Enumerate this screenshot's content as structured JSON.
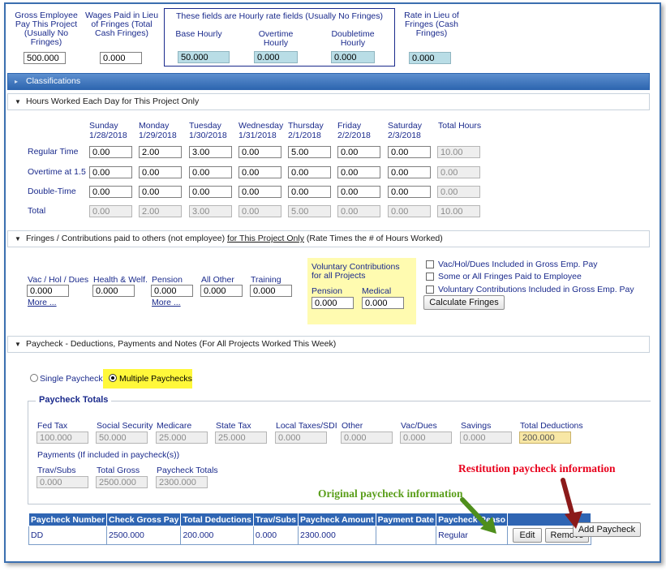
{
  "top": {
    "gross_label": "Gross Employee Pay This Project (Usually No Fringes)",
    "gross_value": "500.000",
    "wages_label": "Wages Paid in Lieu of Fringes (Total Cash Fringes)",
    "wages_value": "0.000",
    "hourly_box_title": "These fields are Hourly rate fields (Usually No Fringes)",
    "base_label": "Base Hourly",
    "base_value": "50.000",
    "overtime_label": "Overtime Hourly",
    "overtime_value": "0.000",
    "doubletime_label": "Doubletime Hourly",
    "doubletime_value": "0.000",
    "rate_label": "Rate in Lieu of Fringes (Cash Fringes)",
    "rate_value": "0.000"
  },
  "classifications": {
    "label": "Classifications"
  },
  "hours": {
    "header": "Hours Worked Each Day for This Project Only",
    "days": [
      {
        "name": "Sunday",
        "date": "1/28/2018"
      },
      {
        "name": "Monday",
        "date": "1/29/2018"
      },
      {
        "name": "Tuesday",
        "date": "1/30/2018"
      },
      {
        "name": "Wednesday",
        "date": "1/31/2018"
      },
      {
        "name": "Thursday",
        "date": "2/1/2018"
      },
      {
        "name": "Friday",
        "date": "2/2/2018"
      },
      {
        "name": "Saturday",
        "date": "2/3/2018"
      }
    ],
    "total_hours_label": "Total Hours",
    "rows": [
      {
        "label": "Regular Time",
        "values": [
          "0.00",
          "2.00",
          "3.00",
          "0.00",
          "5.00",
          "0.00",
          "0.00"
        ],
        "total": "10.00"
      },
      {
        "label": "Overtime at 1.5",
        "values": [
          "0.00",
          "0.00",
          "0.00",
          "0.00",
          "0.00",
          "0.00",
          "0.00"
        ],
        "total": "0.00"
      },
      {
        "label": "Double-Time",
        "values": [
          "0.00",
          "0.00",
          "0.00",
          "0.00",
          "0.00",
          "0.00",
          "0.00"
        ],
        "total": "0.00"
      },
      {
        "label": "Total",
        "values": [
          "0.00",
          "2.00",
          "3.00",
          "0.00",
          "5.00",
          "0.00",
          "0.00"
        ],
        "total": "10.00"
      }
    ]
  },
  "fringes": {
    "header_pre": "Fringes / Contributions paid to others (not employee) ",
    "header_link": "for This Project Only",
    "header_post": " (Rate Times the # of Hours Worked)",
    "vac_label": "Vac / Hol / Dues",
    "vac_value": "0.000",
    "health_label": "Health & Welf.",
    "health_value": "0.000",
    "pension_label": "Pension",
    "pension_value": "0.000",
    "allother_label": "All Other",
    "allother_value": "0.000",
    "training_label": "Training",
    "training_value": "0.000",
    "more_label": "More ...",
    "voluntary_title": "Voluntary Contributions for all Projects",
    "vol_pension_label": "Pension",
    "vol_pension_value": "0.000",
    "vol_medical_label": "Medical",
    "vol_medical_value": "0.000",
    "check1": "Vac/Hol/Dues Included in Gross Emp. Pay",
    "check2": "Some or All Fringes Paid to Employee",
    "check3": "Voluntary Contributions Included in Gross Emp. Pay",
    "calc_button": "Calculate Fringes"
  },
  "paycheck": {
    "header": "Paycheck - Deductions, Payments and Notes (For All Projects Worked This Week)",
    "single_label": "Single Paycheck",
    "multiple_label": "Multiple Paychecks",
    "totals_title": "Paycheck Totals",
    "fields": [
      {
        "label": "Fed Tax",
        "value": "100.000"
      },
      {
        "label": "Social Security",
        "value": "50.000"
      },
      {
        "label": "Medicare",
        "value": "25.000"
      },
      {
        "label": "State Tax",
        "value": "25.000"
      },
      {
        "label": "Local Taxes/SDI",
        "value": "0.000"
      },
      {
        "label": "Other",
        "value": "0.000"
      },
      {
        "label": "Vac/Dues",
        "value": "0.000"
      },
      {
        "label": "Savings",
        "value": "0.000"
      },
      {
        "label": "Total Deductions",
        "value": "200.000"
      }
    ],
    "payments_label": "Payments (If included in paycheck(s))",
    "trav_label": "Trav/Subs",
    "trav_value": "0.000",
    "total_gross_label": "Total Gross",
    "total_gross_value": "2500.000",
    "paycheck_totals_label": "Paycheck Totals",
    "paycheck_totals_value": "2300.000"
  },
  "annotations": {
    "restitution": "Restitution paycheck information",
    "original": "Original paycheck information"
  },
  "table": {
    "columns": [
      "Paycheck Number",
      "Check Gross Pay",
      "Total Deductions",
      "Trav/Subs",
      "Paycheck Amount",
      "Payment Date",
      "Paycheck Reaso"
    ],
    "row": [
      "DD",
      "2500.000",
      "200.000",
      "0.000",
      "2300.000",
      "",
      "Regular"
    ],
    "edit_label": "Edit",
    "remove_label": "Remove"
  },
  "add_paycheck_label": "Add Paycheck",
  "colors": {
    "header_blue": "#2f65b3",
    "annotation_red": "#e8001c",
    "annotation_green": "#5a9e1a",
    "highlight_yellow": "#fffbb0"
  }
}
